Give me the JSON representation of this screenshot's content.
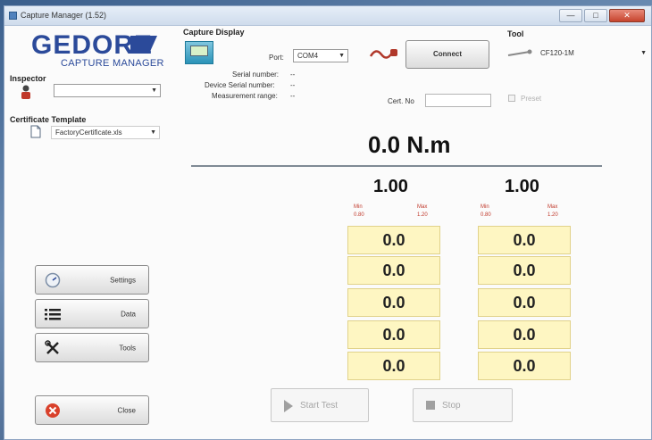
{
  "window": {
    "title": "Capture Manager (1.52)",
    "minimize": "—",
    "maximize": "□",
    "close": "✕"
  },
  "logo": {
    "main": "GEDORE",
    "sub": "CAPTURE MANAGER"
  },
  "inspector": {
    "label": "Inspector",
    "value": ""
  },
  "certificate": {
    "label": "Certificate Template",
    "value": "FactoryCertificate.xls"
  },
  "capture": {
    "label": "Capture Display",
    "port_label": "Port:",
    "port_value": "COM4",
    "serial_label": "Serial number:",
    "serial_value": "--",
    "device_serial_label": "Device Serial number:",
    "device_serial_value": "--",
    "range_label": "Measurement range:",
    "range_value": "--",
    "connect": "Connect",
    "cert_label": "Cert. No"
  },
  "tool": {
    "label": "Tool",
    "value": "CF120-1M",
    "preset_label": "Preset"
  },
  "reading": "0.0  N.m",
  "columns": [
    {
      "value": "1.00",
      "min_label": "Min",
      "max_label": "Max",
      "min_value": "0.80",
      "max_value": "1.20",
      "cells": [
        "0.0",
        "0.0",
        "0.0",
        "0.0",
        "0.0"
      ]
    },
    {
      "value": "1.00",
      "min_label": "Min",
      "max_label": "Max",
      "min_value": "0.80",
      "max_value": "1.20",
      "cells": [
        "0.0",
        "0.0",
        "0.0",
        "0.0",
        "0.0"
      ]
    }
  ],
  "side_buttons": {
    "settings": "Settings",
    "data": "Data",
    "tools": "Tools",
    "close": "Close"
  },
  "actions": {
    "start": "Start Test",
    "stop": "Stop"
  },
  "colors": {
    "brand": "#2b4a9a",
    "cell_bg": "#fef6c2",
    "limit_text": "#c0392b"
  }
}
